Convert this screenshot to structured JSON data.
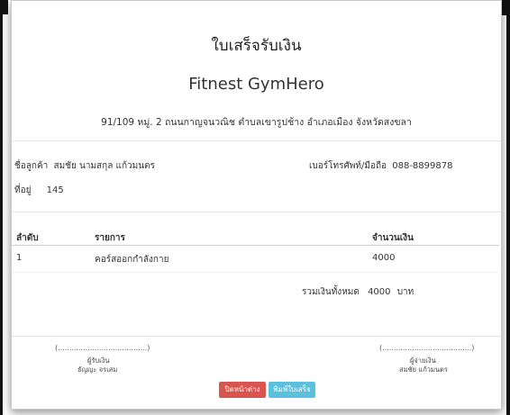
{
  "receipt": {
    "title": "ใบเสร็จรับเงิน",
    "company": "Fitnest GymHero",
    "address": "91/109 หมู่. 2 ถนนกาญจนวณิช ตำบลเขารูปช้าง อำเภอเมือง จังหวัดสงขลา",
    "customer_label": "ชื่อลูกค้า",
    "customer_name": "สมชัย นามสกุล แก้วมนตร",
    "phone_label": "เบอร์โทรศัพท์/มือถือ",
    "phone": "088-8899878",
    "house_label": "ที่อยู่",
    "house_no": "145"
  },
  "table": {
    "headers": [
      "ลำดับ",
      "รายการ",
      "จำนวนเงิน"
    ],
    "rows": [
      {
        "no": "1",
        "item": "คอร์สออกกำลังกาย",
        "amount": "4000"
      }
    ],
    "total_label": "รวมเงินทั้งหมด",
    "total_value": "4000",
    "total_unit": "บาท"
  },
  "signatures": {
    "left_line": "(.......................................)",
    "left_role": "ผู้รับเงิน",
    "left_name": "ธัญญะ จรเสม",
    "right_line": "(.......................................)",
    "right_role": "ผู้จ่ายเงิน",
    "right_name": "สมชัย แก้วมนตร"
  },
  "buttons": {
    "close": "ปิดหน้าต่าง",
    "print": "พิมพ์ใบเสร็จ"
  },
  "colors": {
    "close_button": "#d9534f",
    "print_button": "#5bc0de"
  }
}
